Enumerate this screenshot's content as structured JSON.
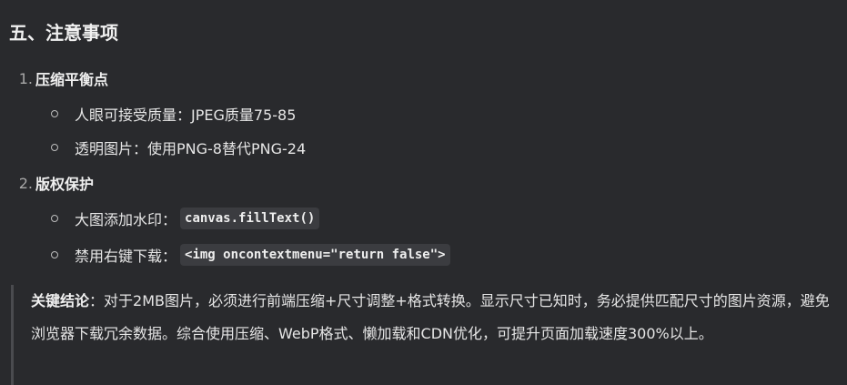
{
  "heading": "五、注意事项",
  "sections": [
    {
      "number": "1.",
      "title": "压缩平衡点",
      "items": [
        {
          "text": "人眼可接受质量：JPEG质量75-85",
          "code": null
        },
        {
          "text": "透明图片：使用PNG-8替代PNG-24",
          "code": null
        }
      ]
    },
    {
      "number": "2.",
      "title": "版权保护",
      "items": [
        {
          "text": "大图添加水印：",
          "code": "canvas.fillText()"
        },
        {
          "text": "禁用右键下载：",
          "code": "<img oncontextmenu=\"return false\">"
        }
      ]
    }
  ],
  "conclusion": {
    "label": "关键结论",
    "text": "：对于2MB图片，必须进行前端压缩+尺寸调整+格式转换。显示尺寸已知时，务必提供匹配尺寸的图片资源，避免浏览器下载冗余数据。综合使用压缩、WebP格式、懒加载和CDN优化，可提升页面加载速度300%以上。"
  }
}
